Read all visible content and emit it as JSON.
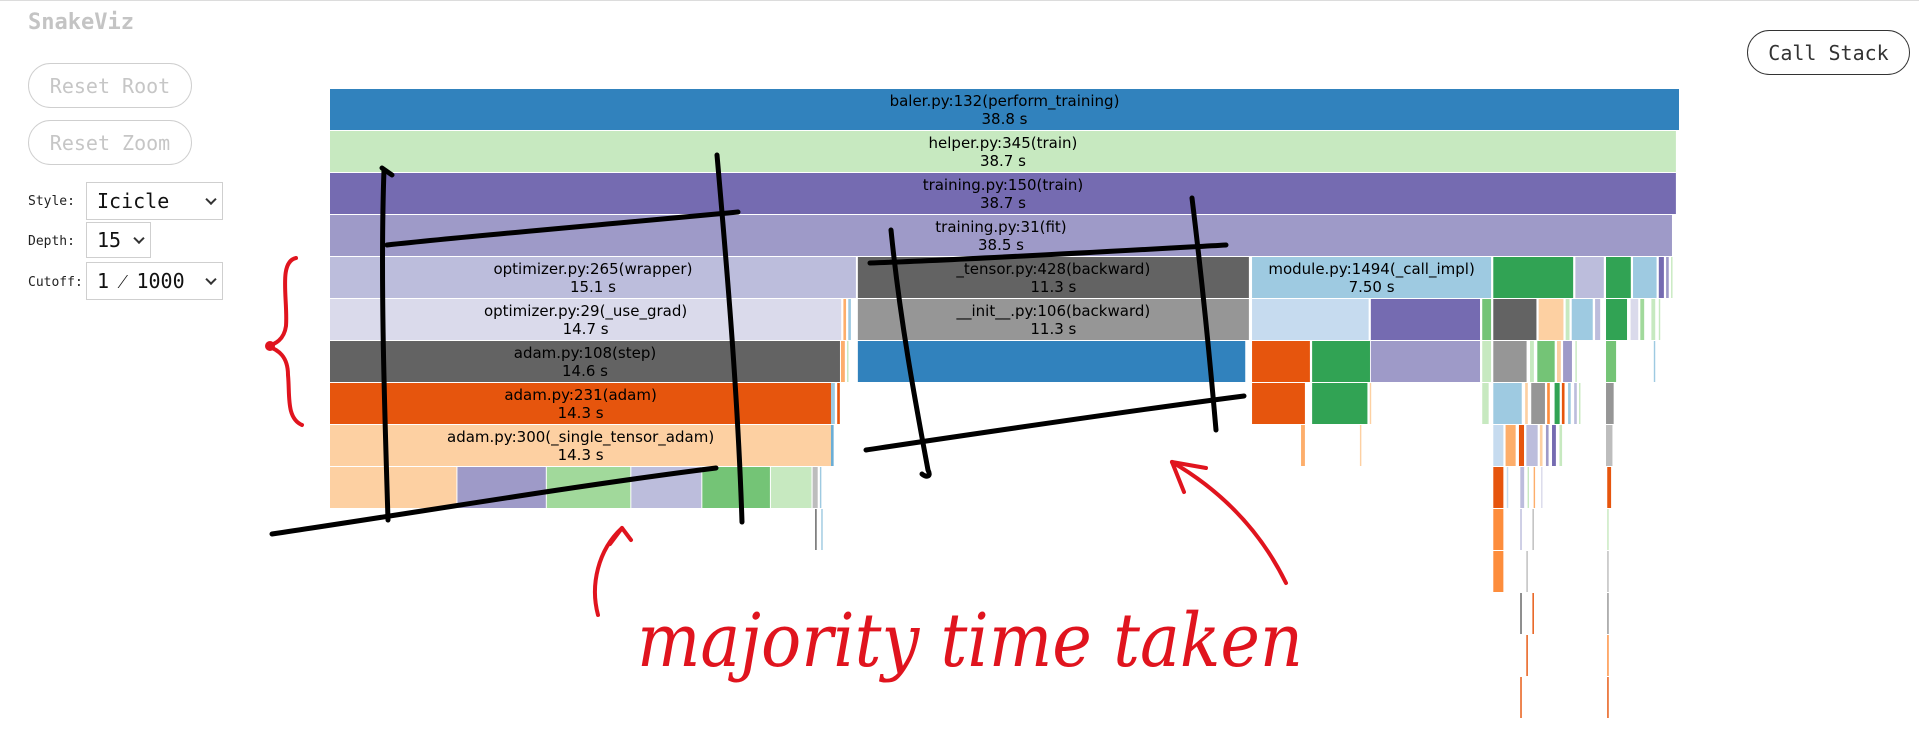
{
  "app": {
    "title": "SnakeViz"
  },
  "controls": {
    "reset_root": "Reset Root",
    "reset_zoom": "Reset Zoom",
    "call_stack": "Call Stack",
    "style_label": "Style:",
    "style_value": "Icicle",
    "depth_label": "Depth:",
    "depth_value": "15",
    "cutoff_label": "Cutoff:",
    "cutoff_value": "1 ⁄ 1000"
  },
  "flame": {
    "nodes": [
      {
        "depth": 0,
        "start": 0.0,
        "width": 1.0,
        "color": "#3182bd",
        "name": "baler.py:132(perform_training)",
        "time": "38.8 s"
      },
      {
        "depth": 1,
        "start": 0.0,
        "width": 0.9977,
        "color": "#c7e9c0",
        "name": "helper.py:345(train)",
        "time": "38.7 s"
      },
      {
        "depth": 2,
        "start": 0.0,
        "width": 0.9977,
        "color": "#756bb1",
        "name": "training.py:150(train)",
        "time": "38.7 s"
      },
      {
        "depth": 3,
        "start": 0.0,
        "width": 0.9948,
        "color": "#9e9ac8",
        "name": "training.py:31(fit)",
        "time": "38.5 s"
      },
      {
        "depth": 4,
        "start": 0.0,
        "width": 0.3903,
        "color": "#bcbddc",
        "name": "optimizer.py:265(wrapper)",
        "time": "15.1 s"
      },
      {
        "depth": 4,
        "start": 0.391,
        "width": 0.2904,
        "color": "#636363",
        "name": "_tensor.py:428(backward)",
        "time": "11.3 s"
      },
      {
        "depth": 4,
        "start": 0.683,
        "width": 0.1778,
        "color": "#9ecae1",
        "name": "module.py:1494(_call_impl)",
        "time": "7.50 s"
      },
      {
        "depth": 5,
        "start": 0.0,
        "width": 0.3794,
        "color": "#dadaeb",
        "name": "optimizer.py:29(_use_grad)",
        "time": "14.7 s"
      },
      {
        "depth": 5,
        "start": 0.391,
        "width": 0.2904,
        "color": "#969696",
        "name": "__init__.py:106(backward)",
        "time": "11.3 s"
      },
      {
        "depth": 6,
        "start": 0.0,
        "width": 0.3785,
        "color": "#636363",
        "name": "adam.py:108(step)",
        "time": "14.6 s"
      },
      {
        "depth": 7,
        "start": 0.0,
        "width": 0.372,
        "color": "#e6550d",
        "name": "adam.py:231(adam)",
        "time": "14.3 s"
      },
      {
        "depth": 8,
        "start": 0.0,
        "width": 0.372,
        "color": "#fdd0a2",
        "name": "adam.py:300(_single_tensor_adam)",
        "time": "14.3 s"
      },
      {
        "depth": 4,
        "start": 0.8617,
        "width": 0.0599,
        "color": "#31a354",
        "name": "",
        "time": ""
      },
      {
        "depth": 4,
        "start": 0.9225,
        "width": 0.0218,
        "color": "#bcbddc",
        "name": "",
        "time": ""
      },
      {
        "depth": 4,
        "start": 0.9452,
        "width": 0.0191,
        "color": "#31a354",
        "name": "",
        "time": ""
      },
      {
        "depth": 4,
        "start": 0.9652,
        "width": 0.0182,
        "color": "#9ecae1",
        "name": "",
        "time": ""
      },
      {
        "depth": 4,
        "start": 0.9843,
        "width": 0.0045,
        "color": "#756bb1",
        "name": "",
        "time": ""
      },
      {
        "depth": 4,
        "start": 0.9897,
        "width": 0.0027,
        "color": "#9e9ac8",
        "name": "",
        "time": ""
      },
      {
        "depth": 4,
        "start": 0.9934,
        "width": 0.0018,
        "color": "#c7e9c0",
        "name": "",
        "time": ""
      },
      {
        "depth": 5,
        "start": 0.683,
        "width": 0.0871,
        "color": "#c6dbef",
        "name": "",
        "time": ""
      },
      {
        "depth": 5,
        "start": 0.771,
        "width": 0.0816,
        "color": "#756bb1",
        "name": "",
        "time": ""
      },
      {
        "depth": 5,
        "start": 0.8535,
        "width": 0.0073,
        "color": "#74c476",
        "name": "",
        "time": ""
      },
      {
        "depth": 5,
        "start": 0.8617,
        "width": 0.0327,
        "color": "#636363",
        "name": "",
        "time": ""
      },
      {
        "depth": 5,
        "start": 0.8953,
        "width": 0.0191,
        "color": "#fdd0a2",
        "name": "",
        "time": ""
      },
      {
        "depth": 5,
        "start": 0.9153,
        "width": 0.0036,
        "color": "#c7e9c0",
        "name": "",
        "time": ""
      },
      {
        "depth": 5,
        "start": 0.9198,
        "width": 0.0163,
        "color": "#9ecae1",
        "name": "",
        "time": ""
      },
      {
        "depth": 5,
        "start": 0.9371,
        "width": 0.0045,
        "color": "#bcbddc",
        "name": "",
        "time": ""
      },
      {
        "depth": 5,
        "start": 0.9452,
        "width": 0.0163,
        "color": "#31a354",
        "name": "",
        "time": ""
      },
      {
        "depth": 5,
        "start": 0.9634,
        "width": 0.0064,
        "color": "#dadaeb",
        "name": "",
        "time": ""
      },
      {
        "depth": 5,
        "start": 0.9706,
        "width": 0.0036,
        "color": "#a1d99b",
        "name": "",
        "time": ""
      },
      {
        "depth": 5,
        "start": 0.9788,
        "width": 0.0036,
        "color": "#c7e9c0",
        "name": "",
        "time": ""
      },
      {
        "depth": 5,
        "start": 0.9843,
        "width": 0.0018,
        "color": "#c7e9c0",
        "name": "",
        "time": ""
      },
      {
        "depth": 5,
        "start": 0.3803,
        "width": 0.0027,
        "color": "#fdae6b",
        "name": "",
        "time": ""
      },
      {
        "depth": 5,
        "start": 0.3839,
        "width": 0.0027,
        "color": "#9ecae1",
        "name": "",
        "time": ""
      },
      {
        "depth": 6,
        "start": 0.391,
        "width": 0.2877,
        "color": "#3182bd",
        "name": "",
        "time": ""
      },
      {
        "depth": 6,
        "start": 0.683,
        "width": 0.0436,
        "color": "#e6550d",
        "name": "",
        "time": ""
      },
      {
        "depth": 6,
        "start": 0.7275,
        "width": 0.0436,
        "color": "#31a354",
        "name": "",
        "time": ""
      },
      {
        "depth": 6,
        "start": 0.771,
        "width": 0.0816,
        "color": "#9e9ac8",
        "name": "",
        "time": ""
      },
      {
        "depth": 6,
        "start": 0.8535,
        "width": 0.0073,
        "color": "#c7e9c0",
        "name": "",
        "time": ""
      },
      {
        "depth": 6,
        "start": 0.8617,
        "width": 0.0254,
        "color": "#969696",
        "name": "",
        "time": ""
      },
      {
        "depth": 6,
        "start": 0.8889,
        "width": 0.0036,
        "color": "#c7e9c0",
        "name": "",
        "time": ""
      },
      {
        "depth": 6,
        "start": 0.8943,
        "width": 0.0136,
        "color": "#74c476",
        "name": "",
        "time": ""
      },
      {
        "depth": 6,
        "start": 0.9089,
        "width": 0.0036,
        "color": "#fdd0a2",
        "name": "",
        "time": ""
      },
      {
        "depth": 6,
        "start": 0.9134,
        "width": 0.0073,
        "color": "#9e9ac8",
        "name": "",
        "time": ""
      },
      {
        "depth": 6,
        "start": 0.9225,
        "width": 0.0018,
        "color": "#c7e9c0",
        "name": "",
        "time": ""
      },
      {
        "depth": 6,
        "start": 0.9452,
        "width": 0.0082,
        "color": "#74c476",
        "name": "",
        "time": ""
      },
      {
        "depth": 6,
        "start": 0.9806,
        "width": 0.0018,
        "color": "#9ecae1",
        "name": "",
        "time": ""
      },
      {
        "depth": 6,
        "start": 0.3785,
        "width": 0.0036,
        "color": "#fdae6b",
        "name": "",
        "time": ""
      },
      {
        "depth": 6,
        "start": 0.383,
        "width": 0.0018,
        "color": "#c7e9c0",
        "name": "",
        "time": ""
      },
      {
        "depth": 7,
        "start": 0.683,
        "width": 0.0399,
        "color": "#e6550d",
        "name": "",
        "time": ""
      },
      {
        "depth": 7,
        "start": 0.7275,
        "width": 0.0417,
        "color": "#31a354",
        "name": "",
        "time": ""
      },
      {
        "depth": 7,
        "start": 0.7702,
        "width": 0.0018,
        "color": "#fdd0a2",
        "name": "",
        "time": ""
      },
      {
        "depth": 7,
        "start": 0.8535,
        "width": 0.0055,
        "color": "#c7e9c0",
        "name": "",
        "time": ""
      },
      {
        "depth": 7,
        "start": 0.8617,
        "width": 0.0218,
        "color": "#9ecae1",
        "name": "",
        "time": ""
      },
      {
        "depth": 7,
        "start": 0.8853,
        "width": 0.0027,
        "color": "#fdd0a2",
        "name": "",
        "time": ""
      },
      {
        "depth": 7,
        "start": 0.8898,
        "width": 0.0109,
        "color": "#969696",
        "name": "",
        "time": ""
      },
      {
        "depth": 7,
        "start": 0.9016,
        "width": 0.0027,
        "color": "#fd8d3c",
        "name": "",
        "time": ""
      },
      {
        "depth": 7,
        "start": 0.9071,
        "width": 0.0045,
        "color": "#31a354",
        "name": "",
        "time": ""
      },
      {
        "depth": 7,
        "start": 0.9125,
        "width": 0.0027,
        "color": "#e6550d",
        "name": "",
        "time": ""
      },
      {
        "depth": 7,
        "start": 0.9171,
        "width": 0.0027,
        "color": "#9ecae1",
        "name": "",
        "time": ""
      },
      {
        "depth": 7,
        "start": 0.9216,
        "width": 0.0027,
        "color": "#bcbddc",
        "name": "",
        "time": ""
      },
      {
        "depth": 7,
        "start": 0.9252,
        "width": 0.0018,
        "color": "#c7e9c0",
        "name": "",
        "time": ""
      },
      {
        "depth": 7,
        "start": 0.9452,
        "width": 0.0064,
        "color": "#969696",
        "name": "",
        "time": ""
      },
      {
        "depth": 7,
        "start": 0.3711,
        "width": 0.0036,
        "color": "#9ecae1",
        "name": "",
        "time": ""
      },
      {
        "depth": 7,
        "start": 0.3757,
        "width": 0.0027,
        "color": "#e6550d",
        "name": "",
        "time": ""
      },
      {
        "depth": 8,
        "start": 0.7193,
        "width": 0.0036,
        "color": "#fdae6b",
        "name": "",
        "time": ""
      },
      {
        "depth": 8,
        "start": 0.7629,
        "width": 0.0018,
        "color": "#fdd0a2",
        "name": "",
        "time": ""
      },
      {
        "depth": 8,
        "start": 0.8617,
        "width": 0.0082,
        "color": "#c6dbef",
        "name": "",
        "time": ""
      },
      {
        "depth": 8,
        "start": 0.8708,
        "width": 0.0082,
        "color": "#fdae6b",
        "name": "",
        "time": ""
      },
      {
        "depth": 8,
        "start": 0.8807,
        "width": 0.0045,
        "color": "#e6550d",
        "name": "",
        "time": ""
      },
      {
        "depth": 8,
        "start": 0.8862,
        "width": 0.0091,
        "color": "#bcbddc",
        "name": "",
        "time": ""
      },
      {
        "depth": 8,
        "start": 0.8962,
        "width": 0.0027,
        "color": "#fdd0a2",
        "name": "",
        "time": ""
      },
      {
        "depth": 8,
        "start": 0.9007,
        "width": 0.0027,
        "color": "#9e9ac8",
        "name": "",
        "time": ""
      },
      {
        "depth": 8,
        "start": 0.9052,
        "width": 0.0036,
        "color": "#756bb1",
        "name": "",
        "time": ""
      },
      {
        "depth": 8,
        "start": 0.9107,
        "width": 0.0027,
        "color": "#c7e9c0",
        "name": "",
        "time": ""
      },
      {
        "depth": 8,
        "start": 0.9452,
        "width": 0.0055,
        "color": "#bdbdbd",
        "name": "",
        "time": ""
      },
      {
        "depth": 8,
        "start": 0.3711,
        "width": 0.0027,
        "color": "#6baed6",
        "name": "",
        "time": ""
      },
      {
        "depth": 9,
        "start": 0.0,
        "width": 0.0944,
        "color": "#fdd0a2",
        "name": "",
        "time": ""
      },
      {
        "depth": 9,
        "start": 0.0944,
        "width": 0.0662,
        "color": "#9e9ac8",
        "name": "",
        "time": ""
      },
      {
        "depth": 9,
        "start": 0.1606,
        "width": 0.0626,
        "color": "#a1d99b",
        "name": "",
        "time": ""
      },
      {
        "depth": 9,
        "start": 0.2232,
        "width": 0.0526,
        "color": "#bcbddc",
        "name": "",
        "time": ""
      },
      {
        "depth": 9,
        "start": 0.2758,
        "width": 0.0508,
        "color": "#74c476",
        "name": "",
        "time": ""
      },
      {
        "depth": 9,
        "start": 0.3266,
        "width": 0.0308,
        "color": "#c7e9c0",
        "name": "",
        "time": ""
      },
      {
        "depth": 9,
        "start": 0.3575,
        "width": 0.0045,
        "color": "#bdbdbd",
        "name": "",
        "time": ""
      },
      {
        "depth": 9,
        "start": 0.3629,
        "width": 0.0018,
        "color": "#9ecae1",
        "name": "",
        "time": ""
      },
      {
        "depth": 9,
        "start": 0.8617,
        "width": 0.0082,
        "color": "#e6550d",
        "name": "",
        "time": ""
      },
      {
        "depth": 9,
        "start": 0.8717,
        "width": 0.0018,
        "color": "#c6dbef",
        "name": "",
        "time": ""
      },
      {
        "depth": 9,
        "start": 0.8817,
        "width": 0.0036,
        "color": "#bcbddc",
        "name": "",
        "time": ""
      },
      {
        "depth": 9,
        "start": 0.8871,
        "width": 0.0018,
        "color": "#c7e9c0",
        "name": "",
        "time": ""
      },
      {
        "depth": 9,
        "start": 0.8916,
        "width": 0.0018,
        "color": "#fdae6b",
        "name": "",
        "time": ""
      },
      {
        "depth": 9,
        "start": 0.8971,
        "width": 0.0018,
        "color": "#dadaeb",
        "name": "",
        "time": ""
      },
      {
        "depth": 9,
        "start": 0.9461,
        "width": 0.0036,
        "color": "#e6550d",
        "name": "",
        "time": ""
      },
      {
        "depth": 10,
        "start": 0.8617,
        "width": 0.0082,
        "color": "#fd8d3c",
        "name": "",
        "time": ""
      },
      {
        "depth": 10,
        "start": 0.8817,
        "width": 0.0018,
        "color": "#bcbddc",
        "name": "",
        "time": ""
      },
      {
        "depth": 10,
        "start": 0.8907,
        "width": 0.0018,
        "color": "#bdbdbd",
        "name": "",
        "time": ""
      },
      {
        "depth": 10,
        "start": 0.9461,
        "width": 0.0018,
        "color": "#c7e9c0",
        "name": "",
        "time": ""
      },
      {
        "depth": 10,
        "start": 0.3594,
        "width": 0.0018,
        "color": "#636363",
        "name": "",
        "time": ""
      },
      {
        "depth": 10,
        "start": 0.3639,
        "width": 0.0018,
        "color": "#9ecae1",
        "name": "",
        "time": ""
      },
      {
        "depth": 11,
        "start": 0.8617,
        "width": 0.0082,
        "color": "#fd8d3c",
        "name": "",
        "time": ""
      },
      {
        "depth": 11,
        "start": 0.8862,
        "width": 0.0018,
        "color": "#bdbdbd",
        "name": "",
        "time": ""
      },
      {
        "depth": 11,
        "start": 0.9461,
        "width": 0.0018,
        "color": "#bdbdbd",
        "name": "",
        "time": ""
      },
      {
        "depth": 12,
        "start": 0.8817,
        "width": 0.0018,
        "color": "#636363",
        "name": "",
        "time": ""
      },
      {
        "depth": 12,
        "start": 0.8907,
        "width": 0.0018,
        "color": "#e6550d",
        "name": "",
        "time": ""
      },
      {
        "depth": 12,
        "start": 0.9461,
        "width": 0.0018,
        "color": "#969696",
        "name": "",
        "time": ""
      },
      {
        "depth": 13,
        "start": 0.8862,
        "width": 0.0018,
        "color": "#e6550d",
        "name": "",
        "time": ""
      },
      {
        "depth": 13,
        "start": 0.9461,
        "width": 0.0018,
        "color": "#fd8d3c",
        "name": "",
        "time": ""
      },
      {
        "depth": 14,
        "start": 0.8817,
        "width": 0.0018,
        "color": "#e6550d",
        "name": "",
        "time": ""
      },
      {
        "depth": 14,
        "start": 0.9461,
        "width": 0.0018,
        "color": "#e6550d",
        "name": "",
        "time": ""
      }
    ]
  },
  "annotation": {
    "text": "majority time taken",
    "ink_color": "#e0141e",
    "marker_color": "#000000"
  }
}
